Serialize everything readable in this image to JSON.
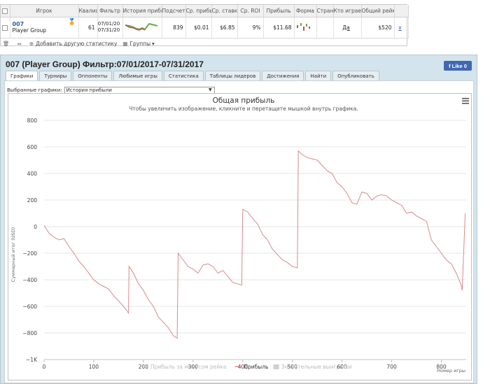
{
  "stats_table": {
    "headers": [
      "Игрок",
      "Квалиф",
      "Фильтр",
      "История прибыл",
      "Подсчет",
      "Ср. прибы",
      "Ср. ставк",
      "Ср. ROI",
      "Прибыль",
      "Форма",
      "Стран",
      "Кто играет",
      "Общий рейк",
      ""
    ],
    "row": {
      "player_id": "007",
      "player_name": "Player Group",
      "qualify": "61",
      "filter_start": "07/01/20",
      "filter_end": "07/31/20",
      "count": "839",
      "avg_profit": "$0.01",
      "avg_stake": "$6.85",
      "avg_roi": "9%",
      "profit": "$11.68",
      "who_plays": "Да",
      "total_rake": "$520",
      "close": "x"
    },
    "toolbar": {
      "add_stats": "Добавить другую статистику",
      "groups": "Группы"
    }
  },
  "panel": {
    "title": "007 (Player Group) Фильтр:07/01/2017-07/31/2017",
    "like_label": "Like 0",
    "tabs": [
      "Графики",
      "Турниры",
      "Оппоненты",
      "Любимые игры",
      "Статистика",
      "Таблицы лидеров",
      "Достижения",
      "Найти",
      "Опубликовать"
    ],
    "selected_charts_label": "Выбранные графики:",
    "selected_chart_value": "История прибыли"
  },
  "chart_data": {
    "type": "line",
    "title": "Общая прибыль",
    "subtitle": "Чтобы увеличить изображение, кликните и перетащите мышкой внутрь графика.",
    "xlabel": "Номер игры",
    "ylabel": "Суммарный итог (USD)",
    "xlim": [
      0,
      850
    ],
    "ylim": [
      -1000,
      800
    ],
    "x_ticks": [
      "0",
      "100",
      "200",
      "300",
      "400",
      "500",
      "600",
      "700",
      "800"
    ],
    "y_ticks": [
      "800",
      "600",
      "400",
      "200",
      "0",
      "−200",
      "−400",
      "−600",
      "−800",
      "−1K"
    ],
    "series": [
      {
        "name": "Прибыль",
        "color": "#d98a8a",
        "x": [
          0,
          10,
          20,
          30,
          40,
          50,
          60,
          70,
          80,
          90,
          100,
          110,
          120,
          130,
          140,
          150,
          160,
          170,
          171,
          180,
          190,
          200,
          210,
          220,
          230,
          240,
          250,
          260,
          268,
          270,
          280,
          290,
          300,
          310,
          320,
          330,
          340,
          350,
          360,
          380,
          398,
          400,
          410,
          420,
          430,
          440,
          450,
          460,
          470,
          480,
          490,
          500,
          510,
          512,
          520,
          530,
          540,
          550,
          560,
          570,
          580,
          590,
          600,
          610,
          620,
          630,
          640,
          650,
          660,
          670,
          680,
          690,
          700,
          710,
          720,
          730,
          740,
          750,
          760,
          770,
          780,
          790,
          800,
          810,
          820,
          830,
          840,
          842,
          848
        ],
        "values": [
          10,
          -50,
          -80,
          -100,
          -90,
          -150,
          -200,
          -260,
          -300,
          -350,
          -400,
          -430,
          -450,
          -470,
          -520,
          -560,
          -600,
          -650,
          -300,
          -350,
          -430,
          -480,
          -550,
          -600,
          -680,
          -720,
          -760,
          -820,
          -840,
          -200,
          -250,
          -300,
          -320,
          -350,
          -290,
          -280,
          -300,
          -350,
          -330,
          -420,
          -440,
          130,
          110,
          60,
          20,
          -60,
          -100,
          -170,
          -210,
          -250,
          -270,
          -300,
          -310,
          570,
          540,
          520,
          510,
          500,
          460,
          420,
          400,
          330,
          300,
          250,
          180,
          170,
          260,
          250,
          200,
          230,
          240,
          230,
          200,
          180,
          160,
          100,
          110,
          80,
          60,
          40,
          -100,
          -150,
          -200,
          -250,
          -280,
          -350,
          -440,
          -480,
          100
        ]
      }
    ],
    "legend": [
      {
        "label": "Прибыль за минусом рейка",
        "active": false
      },
      {
        "label": "Прибыль",
        "active": true
      },
      {
        "label": "Значительные выигрыши",
        "active": false
      }
    ],
    "legend_placement": "bottom",
    "grid": true,
    "menu_icon": "hamburger-icon"
  }
}
